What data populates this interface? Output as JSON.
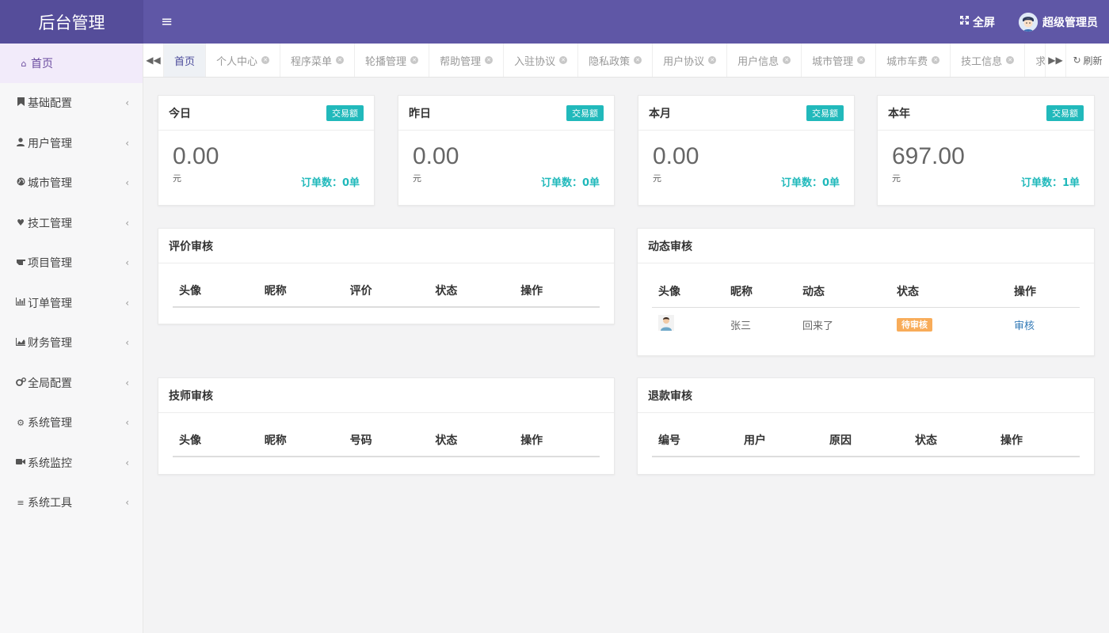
{
  "header": {
    "brand": "后台管理",
    "fullscreen_label": "全屏",
    "user_name": "超级管理员"
  },
  "sidebar": {
    "items": [
      {
        "label": "首页",
        "icon": "home-icon"
      },
      {
        "label": "基础配置",
        "icon": "bookmark-icon"
      },
      {
        "label": "用户管理",
        "icon": "user-icon"
      },
      {
        "label": "城市管理",
        "icon": "globe-icon"
      },
      {
        "label": "技工管理",
        "icon": "heart-icon"
      },
      {
        "label": "项目管理",
        "icon": "hand-icon"
      },
      {
        "label": "订单管理",
        "icon": "bar-chart-icon"
      },
      {
        "label": "财务管理",
        "icon": "area-chart-icon"
      },
      {
        "label": "全局配置",
        "icon": "cogs-icon"
      },
      {
        "label": "系统管理",
        "icon": "gear-icon"
      },
      {
        "label": "系统监控",
        "icon": "video-icon"
      },
      {
        "label": "系统工具",
        "icon": "list-icon"
      }
    ]
  },
  "tabs": {
    "items": [
      "首页",
      "个人中心",
      "程序菜单",
      "轮播管理",
      "帮助管理",
      "入驻协议",
      "隐私政策",
      "用户协议",
      "用户信息",
      "城市管理",
      "城市车费",
      "技工信息",
      "求救报警"
    ],
    "refresh_label": "刷新"
  },
  "stats": [
    {
      "title": "今日",
      "badge": "交易额",
      "value": "0.00",
      "unit": "元",
      "orders": "订单数：0单"
    },
    {
      "title": "昨日",
      "badge": "交易额",
      "value": "0.00",
      "unit": "元",
      "orders": "订单数：0单"
    },
    {
      "title": "本月",
      "badge": "交易额",
      "value": "0.00",
      "unit": "元",
      "orders": "订单数：0单"
    },
    {
      "title": "本年",
      "badge": "交易额",
      "value": "697.00",
      "unit": "元",
      "orders": "订单数：1单"
    }
  ],
  "review_panel": {
    "title": "评价审核",
    "columns": [
      "头像",
      "昵称",
      "评价",
      "状态",
      "操作"
    ]
  },
  "dynamic_panel": {
    "title": "动态审核",
    "columns": [
      "头像",
      "昵称",
      "动态",
      "状态",
      "操作"
    ],
    "rows": [
      {
        "nickname": "张三",
        "content": "回来了",
        "status": "待审核",
        "action": "审核"
      }
    ]
  },
  "tech_panel": {
    "title": "技师审核",
    "columns": [
      "头像",
      "昵称",
      "号码",
      "状态",
      "操作"
    ]
  },
  "refund_panel": {
    "title": "退款审核",
    "columns": [
      "编号",
      "用户",
      "原因",
      "状态",
      "操作"
    ]
  },
  "colors": {
    "header": "#5f57a6",
    "brand_bg": "#554d9a",
    "accent_teal": "#21b9bb",
    "pending_orange": "#f8ac59",
    "active_nav": "#6a4b9f"
  }
}
